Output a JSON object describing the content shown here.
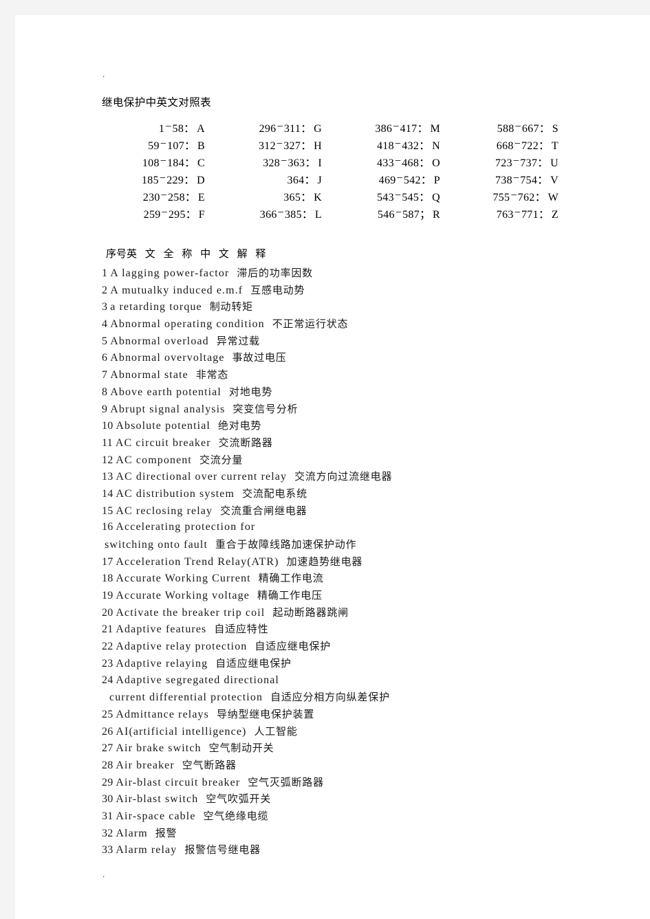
{
  "document": {
    "title": "继电保护中英文对照表",
    "top_mark": ".",
    "bottom_mark": "."
  },
  "index": {
    "rows": [
      [
        {
          "from": "1",
          "dash": "−",
          "to": "58",
          "sep": "：",
          "letter": "A"
        },
        {
          "from": "296",
          "dash": "−",
          "to": "311",
          "sep": "：",
          "letter": "G"
        },
        {
          "from": "386",
          "dash": "−",
          "to": "417",
          "sep": "：",
          "letter": "M"
        },
        {
          "from": "588",
          "dash": "−",
          "to": "667",
          "sep": "：",
          "letter": "S"
        }
      ],
      [
        {
          "from": "59",
          "dash": "−",
          "to": "107",
          "sep": "：",
          "letter": "B"
        },
        {
          "from": "312",
          "dash": "−",
          "to": "327",
          "sep": "：",
          "letter": "H"
        },
        {
          "from": "418",
          "dash": "−",
          "to": "432",
          "sep": "：",
          "letter": "N"
        },
        {
          "from": "668",
          "dash": "−",
          "to": "722",
          "sep": "：",
          "letter": "T"
        }
      ],
      [
        {
          "from": "108",
          "dash": "−",
          "to": "184",
          "sep": "：",
          "letter": "C"
        },
        {
          "from": "328",
          "dash": "−",
          "to": "363",
          "sep": "：",
          "letter": "I"
        },
        {
          "from": "433",
          "dash": "−",
          "to": "468",
          "sep": "：",
          "letter": "O"
        },
        {
          "from": "723",
          "dash": "−",
          "to": "737",
          "sep": "：",
          "letter": "U"
        }
      ],
      [
        {
          "from": "185",
          "dash": "−",
          "to": "229",
          "sep": "：",
          "letter": "D"
        },
        {
          "from": "364",
          "dash": "",
          "to": "",
          "sep": "：",
          "letter": "J"
        },
        {
          "from": "469",
          "dash": "−",
          "to": "542",
          "sep": "：",
          "letter": "P"
        },
        {
          "from": "738",
          "dash": "−",
          "to": "754",
          "sep": "：",
          "letter": "V"
        }
      ],
      [
        {
          "from": "230",
          "dash": "−",
          "to": "258",
          "sep": "：",
          "letter": "E"
        },
        {
          "from": "365",
          "dash": "",
          "to": "",
          "sep": "：",
          "letter": "K"
        },
        {
          "from": "543",
          "dash": "−",
          "to": "545",
          "sep": "：",
          "letter": "Q"
        },
        {
          "from": "755",
          "dash": "−",
          "to": "762",
          "sep": "：",
          "letter": "W"
        }
      ],
      [
        {
          "from": "259",
          "dash": "−",
          "to": "295",
          "sep": "：",
          "letter": "F"
        },
        {
          "from": "366",
          "dash": "−",
          "to": "385",
          "sep": "：",
          "letter": "L"
        },
        {
          "from": "546",
          "dash": "−",
          "to": "587",
          "sep": "；",
          "letter": "R"
        },
        {
          "from": "763",
          "dash": "−",
          "to": "771",
          "sep": "：",
          "letter": "Z"
        }
      ]
    ]
  },
  "list": {
    "header_prefix": "序号",
    "header_spaced": "英 文 全 称 中 文 解 释",
    "entries": [
      {
        "num": "1",
        "en": "A lagging power-factor",
        "zh": "滞后的功率因数"
      },
      {
        "num": "2",
        "en": "A mutualky induced e.m.f",
        "zh": "互感电动势"
      },
      {
        "num": "3",
        "en": "a retarding torque",
        "zh": "制动转矩"
      },
      {
        "num": "4",
        "en": "Abnormal operating condition",
        "zh": "不正常运行状态"
      },
      {
        "num": "5",
        "en": "Abnormal overload",
        "zh": "异常过载"
      },
      {
        "num": "6",
        "en": "Abnormal overvoltage",
        "zh": "事故过电压"
      },
      {
        "num": "7",
        "en": "Abnormal state",
        "zh": "非常态"
      },
      {
        "num": "8",
        "en": "Above earth potential",
        "zh": "对地电势"
      },
      {
        "num": "9",
        "en": "Abrupt signal analysis",
        "zh": "突变信号分析"
      },
      {
        "num": "10",
        "en": "Absolute potential",
        "zh": "绝对电势"
      },
      {
        "num": "11",
        "en": "AC circuit breaker",
        "zh": "交流断路器"
      },
      {
        "num": "12",
        "en": "AC component",
        "zh": "交流分量"
      },
      {
        "num": "13",
        "en": "AC directional over current relay",
        "zh": "交流方向过流继电器"
      },
      {
        "num": "14",
        "en": "AC distribution system",
        "zh": "交流配电系统"
      },
      {
        "num": "15",
        "en": "AC reclosing relay",
        "zh": "交流重合闸继电器"
      },
      {
        "num": "16",
        "en": "Accelerating protection for",
        "zh": ""
      },
      {
        "num": "",
        "en": "switching onto fault",
        "zh": "重合于故障线路加速保护动作",
        "continuation": true
      },
      {
        "num": "17",
        "en": "Acceleration Trend Relay(ATR)",
        "zh": "加速趋势继电器"
      },
      {
        "num": "18",
        "en": "Accurate Working Current",
        "zh": "精确工作电流"
      },
      {
        "num": "19",
        "en": "Accurate Working voltage",
        "zh": "精确工作电压"
      },
      {
        "num": "20",
        "en": "Activate the breaker trip coil",
        "zh": "起动断路器跳闸"
      },
      {
        "num": "21",
        "en": "Adaptive features",
        "zh": "自适应特性"
      },
      {
        "num": "22",
        "en": "Adaptive relay protection",
        "zh": "自适应继电保护"
      },
      {
        "num": "23",
        "en": "Adaptive relaying",
        "zh": "自适应继电保护"
      },
      {
        "num": "24",
        "en": "Adaptive segregated directional",
        "zh": ""
      },
      {
        "num": "",
        "en": "current differential protection",
        "zh": "自适应分相方向纵差保护",
        "continuation": true,
        "indent": true
      },
      {
        "num": "25",
        "en": "Admittance relays",
        "zh": "导纳型继电保护装置"
      },
      {
        "num": "26",
        "en": "AI(artificial intelligence)",
        "zh": "人工智能"
      },
      {
        "num": "27",
        "en": "Air brake switch",
        "zh": "空气制动开关"
      },
      {
        "num": "28",
        "en": "Air breaker",
        "zh": "空气断路器"
      },
      {
        "num": "29",
        "en": "Air-blast circuit breaker",
        "zh": "空气灭弧断路器"
      },
      {
        "num": "30",
        "en": "Air-blast switch",
        "zh": "空气吹弧开关"
      },
      {
        "num": "31",
        "en": "Air-space cable",
        "zh": "空气绝缘电缆"
      },
      {
        "num": "32",
        "en": "Alarm",
        "zh": "报警"
      },
      {
        "num": "33",
        "en": "Alarm relay",
        "zh": "报警信号继电器"
      }
    ]
  }
}
